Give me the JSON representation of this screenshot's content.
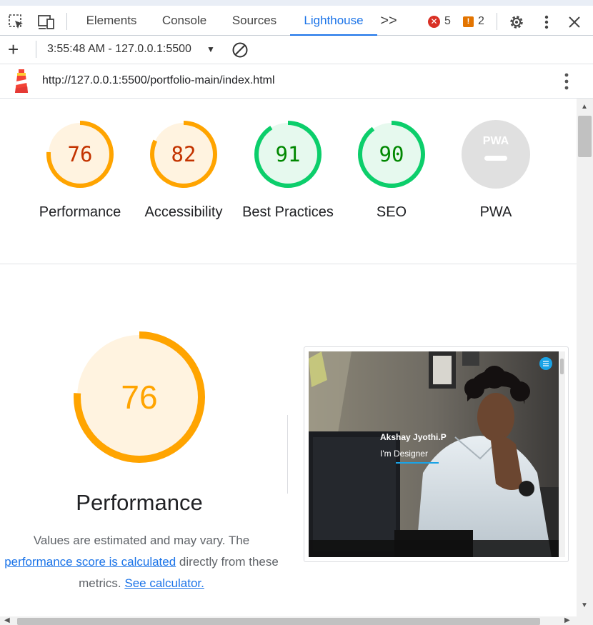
{
  "devtools": {
    "tabs": [
      {
        "label": "Elements",
        "active": false
      },
      {
        "label": "Console",
        "active": false
      },
      {
        "label": "Sources",
        "active": false
      },
      {
        "label": "Lighthouse",
        "active": true
      }
    ],
    "more_tabs_icon": ">>",
    "errors_count": "5",
    "warnings_count": "2",
    "colors": {
      "accent": "#1a73e8",
      "error": "#d93025",
      "warning": "#e37400"
    }
  },
  "toolbar": {
    "new_report_icon": "+",
    "report_selector": "3:55:48 AM - 127.0.0.1:5500",
    "clear_icon": "block-icon"
  },
  "urlbar": {
    "url": "http://127.0.0.1:5500/portfolio-main/index.html"
  },
  "scores": [
    {
      "label": "Performance",
      "value": "76",
      "status": "average",
      "color": "#ffa400",
      "text_color": "#c33300",
      "fill": "#fff3e0"
    },
    {
      "label": "Accessibility",
      "value": "82",
      "status": "average",
      "color": "#ffa400",
      "text_color": "#c33300",
      "fill": "#fff3e0"
    },
    {
      "label": "Best Practices",
      "value": "91",
      "status": "pass",
      "color": "#0cce6b",
      "text_color": "#008800",
      "fill": "#e6f9ee"
    },
    {
      "label": "SEO",
      "value": "90",
      "status": "pass",
      "color": "#0cce6b",
      "text_color": "#008800",
      "fill": "#e6f9ee"
    },
    {
      "label": "PWA",
      "value": "PWA",
      "status": "na",
      "color": "#e0e0e0",
      "text_color": "#ffffff",
      "fill": "#e0e0e0"
    }
  ],
  "performance": {
    "score": "76",
    "title": "Performance",
    "desc_part1": "Values are estimated and may vary. The",
    "desc_link1": "performance score is calculated",
    "desc_part2": " directly from these",
    "desc_part3": "metrics. ",
    "desc_link2": "See calculator."
  },
  "screenshot": {
    "name": "Akshay Jyothi.P",
    "subtitle": "I'm Designer"
  }
}
